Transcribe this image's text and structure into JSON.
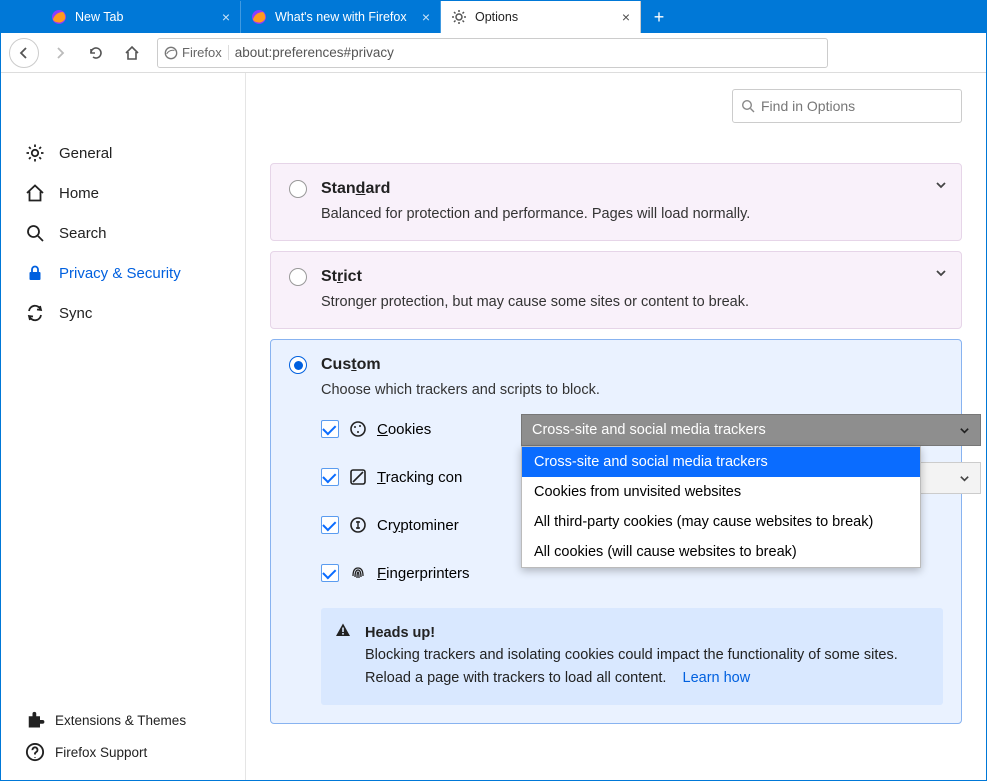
{
  "tabs": [
    {
      "label": "New Tab"
    },
    {
      "label": "What's new with Firefox"
    },
    {
      "label": "Options"
    }
  ],
  "urlbar": {
    "identity": "Firefox",
    "url": "about:preferences#privacy"
  },
  "search": {
    "placeholder": "Find in Options"
  },
  "sidebar": {
    "items": [
      "General",
      "Home",
      "Search",
      "Privacy & Security",
      "Sync"
    ],
    "footer": [
      "Extensions & Themes",
      "Firefox Support"
    ]
  },
  "panels": {
    "standard": {
      "title_pre": "Stan",
      "title_u": "d",
      "title_post": "ard",
      "desc": "Balanced for protection and performance. Pages will load normally."
    },
    "strict": {
      "title_pre": "St",
      "title_u": "r",
      "title_post": "ict",
      "desc": "Stronger protection, but may cause some sites or content to break."
    },
    "custom": {
      "title_pre": "Cus",
      "title_u": "t",
      "title_post": "om",
      "desc": "Choose which trackers and scripts to block."
    }
  },
  "checks": {
    "cookies": {
      "pre": "",
      "u": "C",
      "post": "ookies"
    },
    "tracking": {
      "pre": "",
      "u": "T",
      "post": "racking con"
    },
    "crypto": {
      "pre": "Cr",
      "u": "y",
      "post": "ptominer"
    },
    "finger": {
      "pre": "",
      "u": "F",
      "post": "ingerprinters"
    }
  },
  "dropdown": {
    "selected": "Cross-site and social media trackers",
    "options": [
      "Cross-site and social media trackers",
      "Cookies from unvisited websites",
      "All third-party cookies (may cause websites to break)",
      "All cookies (will cause websites to break)"
    ]
  },
  "heads": {
    "title": "Heads up!",
    "body": "Blocking trackers and isolating cookies could impact the functionality of some sites. Reload a page with trackers to load all content.",
    "link": "Learn how"
  }
}
